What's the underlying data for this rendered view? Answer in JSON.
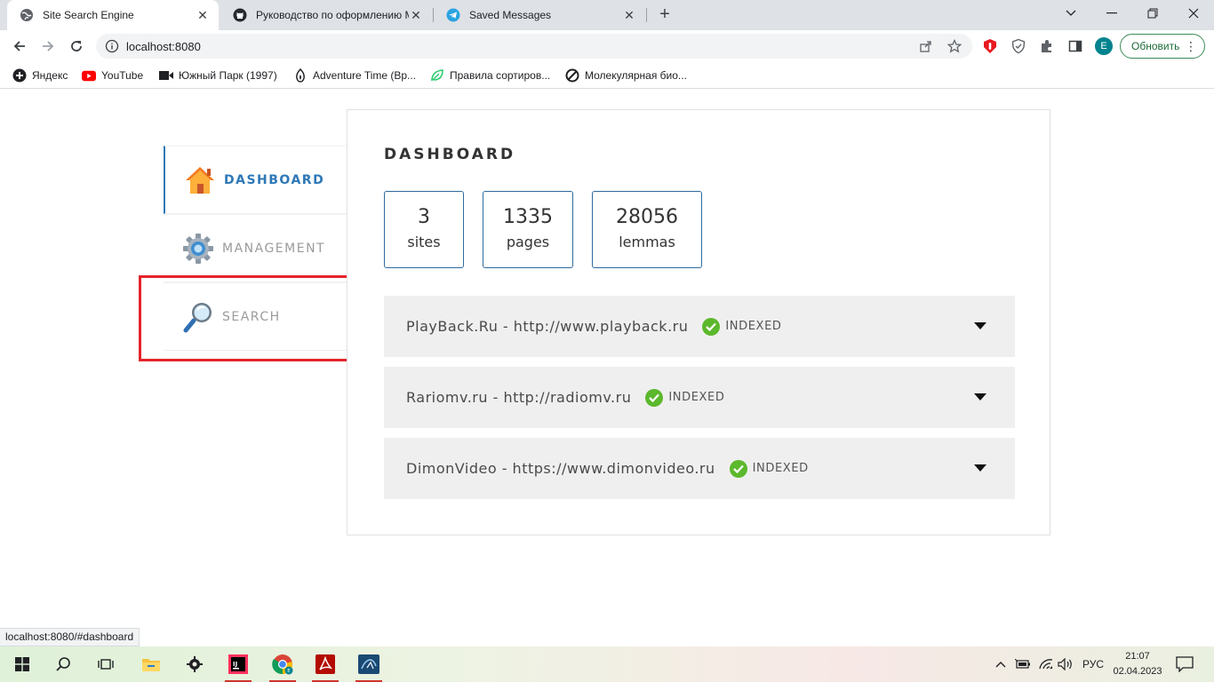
{
  "browser": {
    "tabs": [
      {
        "title": "Site Search Engine",
        "active": true
      },
      {
        "title": "Руководство по оформлению М",
        "active": false
      },
      {
        "title": "Saved Messages",
        "active": false
      }
    ],
    "url": "localhost:8080",
    "update_label": "Обновить",
    "profile_initial": "E",
    "bookmarks": [
      "Яндекс",
      "YouTube",
      "Южный Парк (1997)",
      "Adventure Time (Вр...",
      "Правила сортиров...",
      "Молекулярная био..."
    ],
    "status_url": "localhost:8080/#dashboard"
  },
  "sidebar": {
    "items": [
      {
        "label": "DASHBOARD",
        "icon": "home-icon",
        "active": true
      },
      {
        "label": "MANAGEMENT",
        "icon": "gear-icon",
        "active": false
      },
      {
        "label": "SEARCH",
        "icon": "magnifier-icon",
        "active": false
      }
    ]
  },
  "dashboard": {
    "title": "DASHBOARD",
    "stats": [
      {
        "value": "3",
        "label": "sites"
      },
      {
        "value": "1335",
        "label": "pages"
      },
      {
        "value": "28056",
        "label": "lemmas"
      }
    ],
    "sites": [
      {
        "name": "PlayBack.Ru - http://www.playback.ru",
        "status": "INDEXED"
      },
      {
        "name": "Rariomv.ru - http://radiomv.ru",
        "status": "INDEXED"
      },
      {
        "name": "DimonVideo - https://www.dimonvideo.ru",
        "status": "INDEXED"
      }
    ]
  },
  "taskbar": {
    "language": "РУС",
    "time": "21:07",
    "date": "02.04.2023"
  },
  "colors": {
    "accent": "#2e78b7",
    "highlight_box": "#e5232b",
    "indexed_check": "#5cb82c"
  }
}
